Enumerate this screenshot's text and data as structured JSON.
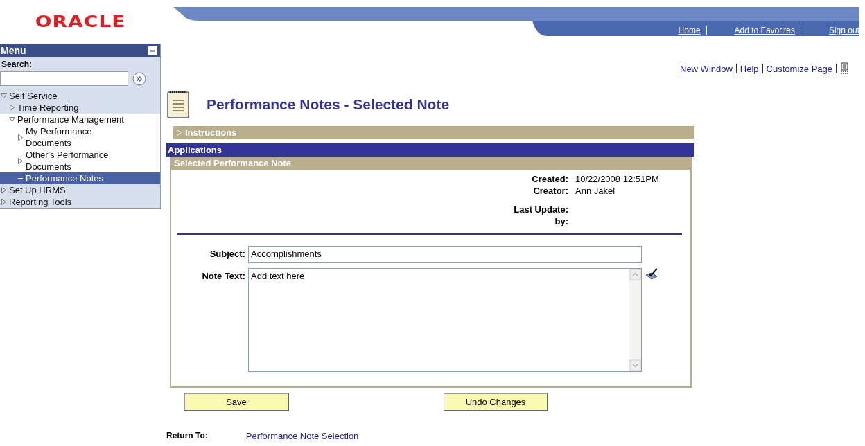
{
  "logo": "ORACLE",
  "header_links": [
    "Home",
    "Add to Favorites",
    "Sign out"
  ],
  "menu": {
    "title": "Menu",
    "search_label": "Search:",
    "items": [
      {
        "label": "Self Service",
        "kind": "folder",
        "expanded": true,
        "selected": false,
        "children": [
          {
            "label": "Time Reporting",
            "kind": "folder",
            "expanded": false,
            "selected": false
          },
          {
            "label": "Performance Management",
            "kind": "folder",
            "expanded": true,
            "selected": false,
            "children": [
              {
                "label": "My Performance Documents",
                "kind": "folder",
                "expanded": false,
                "selected": false
              },
              {
                "label": "Other's Performance Documents",
                "kind": "folder",
                "expanded": false,
                "selected": false
              },
              {
                "label": "Performance Notes",
                "kind": "leaf",
                "selected": true
              }
            ]
          }
        ]
      },
      {
        "label": "Set Up HRMS",
        "kind": "folder",
        "expanded": false,
        "selected": false
      },
      {
        "label": "Reporting Tools",
        "kind": "folder",
        "expanded": false,
        "selected": false
      }
    ]
  },
  "page_links": [
    "New Window",
    "Help",
    "Customize Page"
  ],
  "title": "Performance Notes - Selected Note",
  "instructions": {
    "label": "Instructions",
    "expanded": false
  },
  "section_title": "Applications",
  "panel": {
    "title": "Selected Performance Note",
    "details": [
      {
        "label": "Created:",
        "value": "10/22/2008 12:51PM"
      },
      {
        "label": "Creator:",
        "value": "Ann Jakel"
      },
      {
        "label": "Last Update:"
      },
      {
        "label": "by:"
      }
    ],
    "subject": {
      "label": "Subject:",
      "value": "Accomplishments"
    },
    "note_text": {
      "label": "Note Text:",
      "value": "Add text here"
    }
  },
  "buttons": [
    "Save",
    "Undo Changes"
  ],
  "return_to": {
    "label": "Return To:",
    "link": "Performance Note Selection"
  }
}
